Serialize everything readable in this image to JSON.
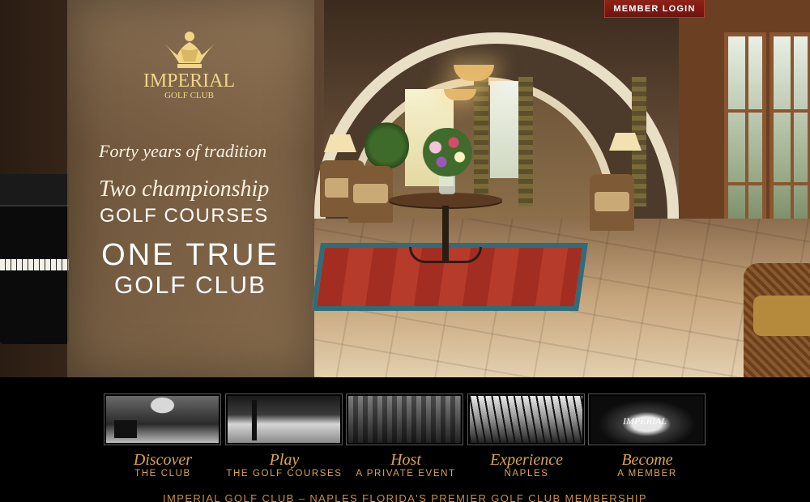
{
  "header": {
    "member_login_label": "MEMBER LOGIN"
  },
  "logo": {
    "name": "IMPERIAL",
    "sub": "GOLF CLUB"
  },
  "hero": {
    "line1": "Forty years of tradition",
    "line2_script": "Two championship",
    "line2_caps": "GOLF COURSES",
    "line3a": "ONE TRUE",
    "line3b": "GOLF CLUB"
  },
  "nav": {
    "items": [
      {
        "script": "Discover",
        "caps": "THE CLUB",
        "thumb_icon": "lobby-photo"
      },
      {
        "script": "Play",
        "caps": "THE GOLF COURSES",
        "thumb_icon": "golf-course-photo"
      },
      {
        "script": "Host",
        "caps": "A PRIVATE EVENT",
        "thumb_icon": "banquet-hall-photo"
      },
      {
        "script": "Experience",
        "caps": "NAPLES",
        "thumb_icon": "beach-photo"
      },
      {
        "script": "Become",
        "caps": "A MEMBER",
        "thumb_icon": "ice-sculpture-logo-photo"
      }
    ],
    "thumb_logo_text": "IMPERIAL"
  },
  "footer": {
    "text": "IMPERIAL GOLF CLUB – NAPLES FLORIDA'S PREMIER GOLF CLUB MEMBERSHIP"
  },
  "colors": {
    "gold": "#d9a451",
    "logo_gold": "#f0d58a",
    "login_red": "#8e2219",
    "background": "#000000"
  }
}
